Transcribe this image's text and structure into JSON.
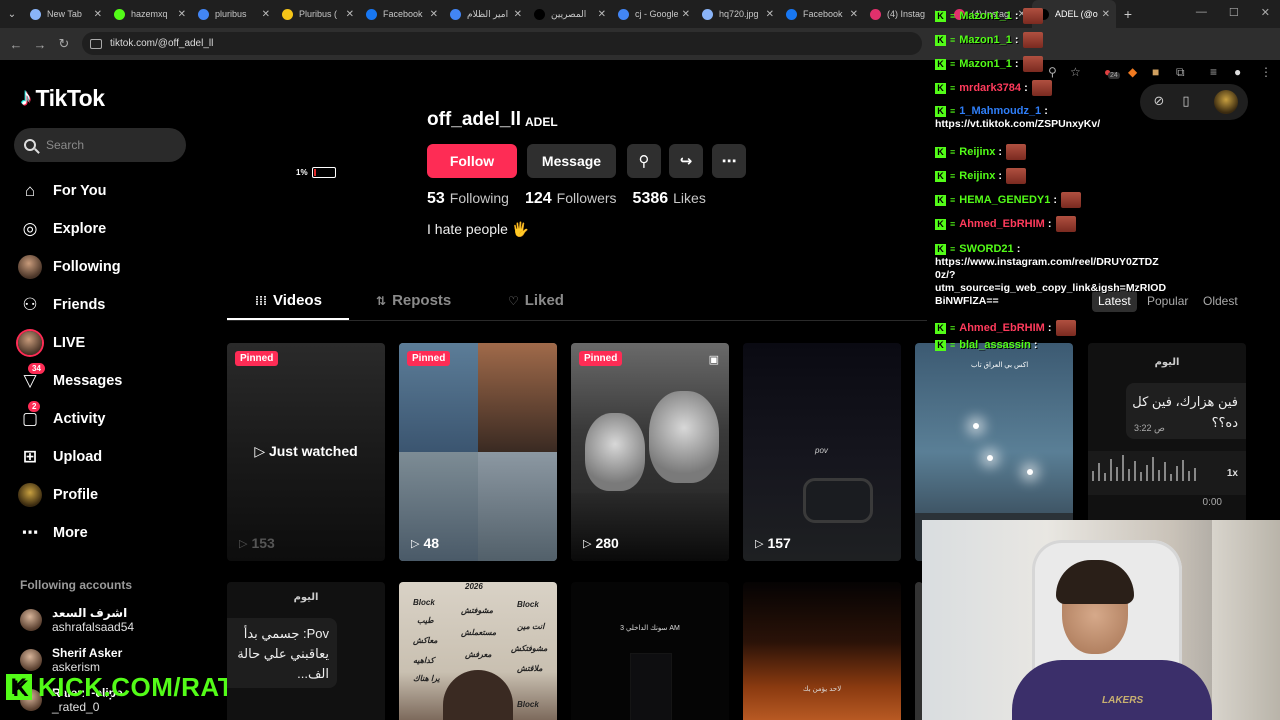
{
  "browser": {
    "tabs": [
      {
        "label": "New Tab",
        "favicon": "globe-icon",
        "color": "#8ab4f8"
      },
      {
        "label": "hazemxq",
        "favicon": "kick-icon",
        "color": "#53fc18"
      },
      {
        "label": "pluribus",
        "favicon": "google-icon",
        "color": "#4285f4"
      },
      {
        "label": "Pluribus (",
        "favicon": "imdb-icon",
        "color": "#f5c518"
      },
      {
        "label": "Facebook",
        "favicon": "facebook-icon",
        "color": "#1877f2"
      },
      {
        "label": "امير الظلام",
        "favicon": "google-icon",
        "color": "#4285f4"
      },
      {
        "label": "المصريين",
        "favicon": "tiktok-icon",
        "color": "#000000"
      },
      {
        "label": "cj - Google",
        "favicon": "google-icon",
        "color": "#4285f4"
      },
      {
        "label": "hq720.jpg",
        "favicon": "globe-icon",
        "color": "#8ab4f8"
      },
      {
        "label": "Facebook",
        "favicon": "facebook-icon",
        "color": "#1877f2"
      },
      {
        "label": "(4) Instag",
        "favicon": "instagram-icon",
        "color": "#e1306c"
      },
      {
        "label": "(4) Instag",
        "favicon": "instagram-icon",
        "color": "#e1306c"
      },
      {
        "label": "ADEL (@off",
        "favicon": "tiktok-icon",
        "color": "#000000",
        "active": true
      }
    ],
    "url": "tiktok.com/@off_adel_ll",
    "ext_badge": "24"
  },
  "sidebar": {
    "logo": "TikTok",
    "search_placeholder": "Search",
    "nav": [
      {
        "label": "For You",
        "icon": "home-icon"
      },
      {
        "label": "Explore",
        "icon": "compass-icon"
      },
      {
        "label": "Following",
        "icon": "following-avatar-icon"
      },
      {
        "label": "Friends",
        "icon": "friends-icon"
      },
      {
        "label": "LIVE",
        "icon": "live-avatar-icon"
      },
      {
        "label": "Messages",
        "icon": "messages-icon",
        "badge": "34"
      },
      {
        "label": "Activity",
        "icon": "activity-icon",
        "badge": "2"
      },
      {
        "label": "Upload",
        "icon": "upload-icon"
      },
      {
        "label": "Profile",
        "icon": "profile-avatar-icon"
      },
      {
        "label": "More",
        "icon": "more-icon"
      }
    ],
    "following_title": "Following accounts",
    "accounts": [
      {
        "name": "اشرف السعد",
        "handle": "ashrafalsaad54"
      },
      {
        "name": "Sherif Asker",
        "handle": "askerism"
      },
      {
        "name": "Raleu Felipe",
        "handle": "_rated_0"
      }
    ],
    "kick_banner": "KICK.COM/RATEDV1"
  },
  "profile": {
    "battery_pct": "1%",
    "battery_level": 0.08,
    "username": "off_adel_ll",
    "nickname": "ADEL",
    "follow_label": "Follow",
    "message_label": "Message",
    "stats": [
      {
        "value": "53",
        "label": "Following"
      },
      {
        "value": "124",
        "label": "Followers"
      },
      {
        "value": "5386",
        "label": "Likes"
      }
    ],
    "bio": "I hate people 🖐️"
  },
  "tabs": {
    "videos": "Videos",
    "reposts": "Reposts",
    "liked": "Liked",
    "sort": [
      "Latest",
      "Popular",
      "Oldest"
    ]
  },
  "videos": [
    {
      "pinned": "Pinned",
      "views": "153",
      "overlay": "Just watched"
    },
    {
      "pinned": "Pinned",
      "views": "48"
    },
    {
      "pinned": "Pinned",
      "views": "280"
    },
    {
      "views": "157",
      "caption": "pov"
    },
    {
      "caption": "اكس بي العراق تاب"
    },
    {
      "date": "اليوم",
      "bubble": "فين هزارك، فين كل ده؟؟",
      "time": "3:22 ص",
      "speed": "1x",
      "duration": "0:00"
    },
    {
      "date": "اليوم",
      "bubble": "Pov: جسمي بدأ يعاقبني علي حالة الف..."
    },
    {
      "caption": "2026"
    },
    {
      "caption": "سونك الداخلي 3 AM"
    },
    {
      "caption": "لاحد يؤمن بك"
    }
  ],
  "chat": [
    {
      "user": "Mazon1_1",
      "color": "#53fc18",
      "emote": true
    },
    {
      "user": "Mazon1_1",
      "color": "#53fc18",
      "emote": true
    },
    {
      "user": "Mazon1_1",
      "color": "#53fc18",
      "emote": true
    },
    {
      "user": "mrdark3784",
      "color": "#ff3b5c",
      "emote": true
    },
    {
      "user": "1_Mahmoudz_1",
      "color": "#2f7ef7",
      "link": "https://vt.tiktok.com/ZSPUnxyKv/"
    },
    {
      "user": "Reijinx",
      "color": "#53fc18",
      "emote": true
    },
    {
      "user": "Reijinx",
      "color": "#53fc18",
      "emote": true
    },
    {
      "user": "HEMA_GENEDY1",
      "color": "#53fc18",
      "emote": true
    },
    {
      "user": "Ahmed_EbRHIM",
      "color": "#ff3b5c",
      "emote": true
    },
    {
      "user": "SWORD21",
      "color": "#53fc18",
      "link": "https://www.instagram.com/reel/DRUY0ZTDZ 0z/? utm_source=ig_web_copy_link&igsh=MzRIOD BiNWFlZA=="
    },
    {
      "user": "Ahmed_EbRHIM",
      "color": "#ff3b5c",
      "emote": true
    },
    {
      "user": "blal_assassin",
      "color": "#53fc18"
    }
  ],
  "colors": {
    "accent": "#fe2c55",
    "kick_green": "#53fc18"
  }
}
